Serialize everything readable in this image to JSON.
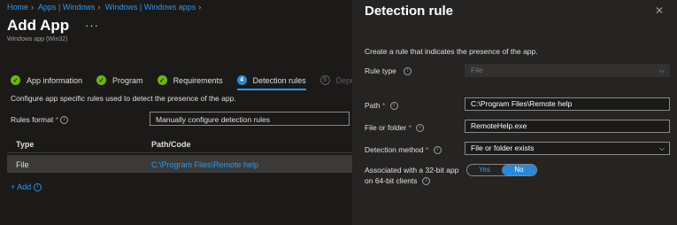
{
  "breadcrumb": [
    "Home",
    "Apps | Windows",
    "Windows | Windows apps"
  ],
  "header": {
    "title": "Add App",
    "more": "···",
    "subtitle": "Windows app (Win32)"
  },
  "steps": [
    {
      "label": "App information",
      "state": "done"
    },
    {
      "label": "Program",
      "state": "done"
    },
    {
      "label": "Requirements",
      "state": "done"
    },
    {
      "label": "Detection rules",
      "state": "current",
      "number": "4"
    },
    {
      "label": "Deper",
      "state": "future",
      "number": "5"
    }
  ],
  "main": {
    "instructions": "Configure app specific rules used to detect the presence of the app.",
    "rules_format_label": "Rules format",
    "rules_format_value": "Manually configure detection rules",
    "table": {
      "headers": [
        "Type",
        "Path/Code"
      ],
      "rows": [
        {
          "type": "File",
          "path": "C:\\Program Files\\Remote help"
        }
      ]
    },
    "add_label": "+ Add"
  },
  "panel": {
    "title": "Detection rule",
    "close": "✕",
    "description": "Create a rule that indicates the presence of the app.",
    "rule_type_label": "Rule type",
    "rule_type_value": "File",
    "path_label": "Path",
    "path_value": "C:\\Program Files\\Remote help",
    "file_label": "File or folder",
    "file_value": "RemoteHelp.exe",
    "method_label": "Detection method",
    "method_value": "File or folder exists",
    "assoc_label_1": "Associated with a 32-bit app",
    "assoc_label_2": "on 64-bit clients",
    "toggle_yes": "Yes",
    "toggle_no": "No",
    "toggle_selected": "No"
  },
  "icons": {
    "info": "info-icon",
    "chevron": "chevron-down-icon",
    "check": "check-icon",
    "close": "close-icon"
  },
  "colors": {
    "accent": "#2899f5",
    "done": "#6bb700",
    "required": "#f1707b"
  }
}
